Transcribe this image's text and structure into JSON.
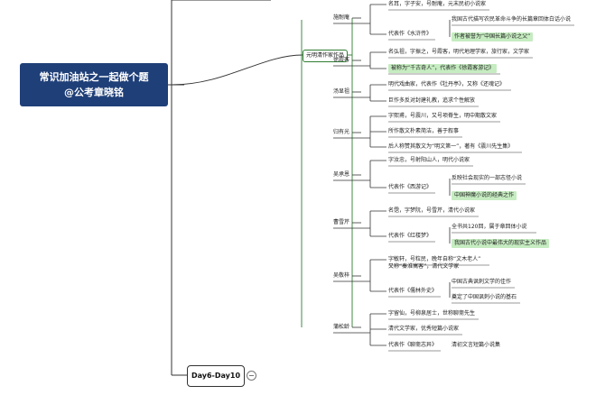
{
  "root": {
    "line1": "常识加油站之一起做个题",
    "line2": "@公考章晓铭"
  },
  "branch": "元明清作家作品",
  "day_node": "Day6-Day10",
  "authors": [
    {
      "id": "shinaian",
      "name": "施耐庵",
      "items": [
        {
          "text": "名耳，字子安，号耐庵，元末民初小说家"
        },
        {
          "text": "代表作《水浒传》",
          "subs": [
            {
              "text": "我国古代描写农民革命斗争的长篇章回体白话小说"
            },
            {
              "text": "作者被誉为“中国长篇小说之父”",
              "hl": true
            }
          ]
        }
      ]
    },
    {
      "id": "xulinglong",
      "name": "徐霞客",
      "items": [
        {
          "text": "名弘祖，字振之，号霞客，明代地理学家，旅行家，文学家"
        },
        {
          "text": "被称为“千古奇人”，代表作《徐霞客游记》",
          "hl": true
        }
      ]
    },
    {
      "id": "tangxianzu",
      "name": "汤显祖",
      "items": [
        {
          "text": "明代戏曲家，代表作《牡丹亭》，又称《还魂记》"
        },
        {
          "text": "巨作多反对封建礼教，追求个性解放"
        }
      ]
    },
    {
      "id": "guiyouguang",
      "name": "归有光",
      "items": [
        {
          "text": "字熙甫，号震川，又号项脊生，明中期散文家"
        },
        {
          "text": "所作散文朴素简洁，善于叙事"
        },
        {
          "text": "后人称赞其散文为“明文第一”，著有《震川先生集》"
        }
      ]
    },
    {
      "id": "wuchengen",
      "name": "吴承恩",
      "items": [
        {
          "text": "字汝忠，号射阳山人，明代小说家"
        },
        {
          "text": "代表作《西游记》",
          "subs": [
            {
              "text": "反映社会现实的一部志怪小说"
            },
            {
              "text": "中国神魔小说的经典之作",
              "hl": true
            }
          ]
        }
      ]
    },
    {
      "id": "caoxueqin",
      "name": "曹雪芹",
      "items": [
        {
          "text": "名霑，字梦阮，号雪芹，清代小说家"
        },
        {
          "text": "代表作《红楼梦》",
          "subs": [
            {
              "text": "全书共120回，属于章回体小说"
            },
            {
              "text": "我国古代小说中最伟大的现实主义作品",
              "hl": true
            }
          ]
        }
      ]
    },
    {
      "id": "wujingzi",
      "name": "吴敬梓",
      "items": [
        {
          "text": "字敏轩，号粒民，晚年自称“文木老人”",
          "text2": "又称“秦淮寓客”，清代文学家"
        },
        {
          "text": "代表作《儒林外史》",
          "subs": [
            {
              "text": "中国古典讽刺文学的佳作"
            },
            {
              "text": "奠定了中国讽刺小说的基石"
            }
          ]
        }
      ]
    },
    {
      "id": "pusongling",
      "name": "蒲松龄",
      "items": [
        {
          "text": "字留仙，号柳泉居士，世称聊斋先生"
        },
        {
          "text": "清代文学家，优秀短篇小说家"
        },
        {
          "text": "代表作《聊斋志异》",
          "subs": [
            {
              "text": "清初文言短篇小说集",
              "inline": true
            }
          ]
        }
      ]
    }
  ]
}
